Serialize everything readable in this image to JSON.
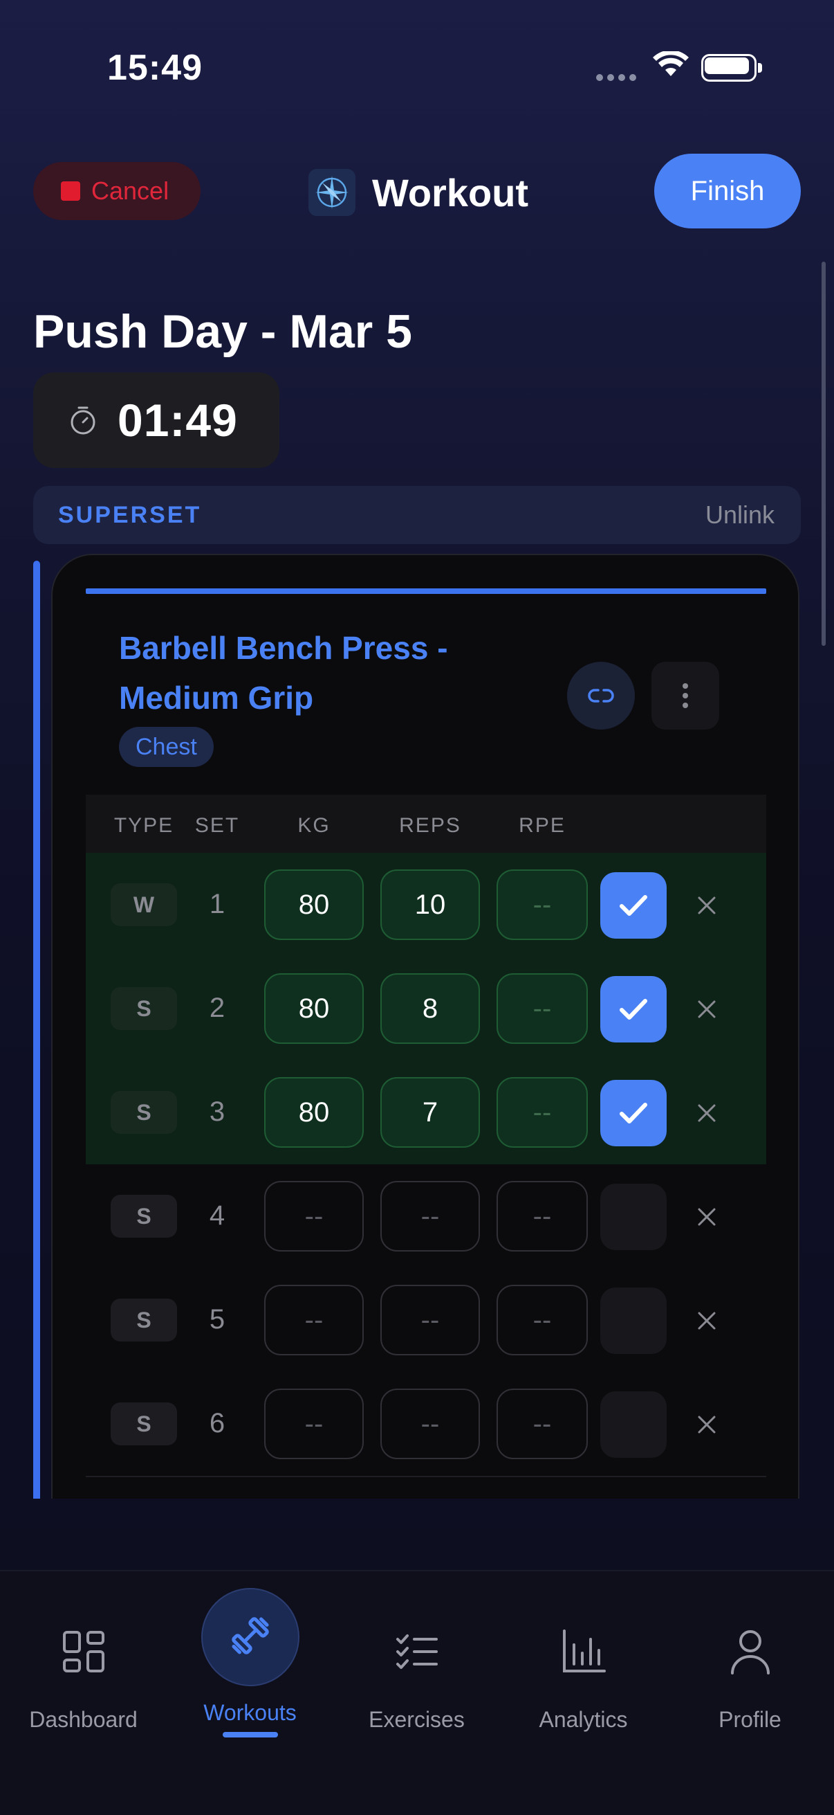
{
  "status_bar": {
    "time": "15:49"
  },
  "header": {
    "cancel_label": "Cancel",
    "title": "Workout",
    "finish_label": "Finish"
  },
  "workout": {
    "title": "Push Day - Mar 5",
    "timer": "01:49"
  },
  "superset": {
    "label": "SUPERSET",
    "unlink_label": "Unlink"
  },
  "exercise": {
    "name_line1": "Barbell Bench Press -",
    "name_line2": "Medium Grip",
    "muscle": "Chest",
    "columns": {
      "type": "TYPE",
      "set": "SET",
      "kg": "KG",
      "reps": "REPS",
      "rpe": "RPE"
    },
    "sets": [
      {
        "type": "W",
        "set": "1",
        "kg": "80",
        "reps": "10",
        "rpe": "--",
        "done": true
      },
      {
        "type": "S",
        "set": "2",
        "kg": "80",
        "reps": "8",
        "rpe": "--",
        "done": true
      },
      {
        "type": "S",
        "set": "3",
        "kg": "80",
        "reps": "7",
        "rpe": "--",
        "done": true
      },
      {
        "type": "S",
        "set": "4",
        "kg": "--",
        "reps": "--",
        "rpe": "--",
        "done": false
      },
      {
        "type": "S",
        "set": "5",
        "kg": "--",
        "reps": "--",
        "rpe": "--",
        "done": false
      },
      {
        "type": "S",
        "set": "6",
        "kg": "--",
        "reps": "--",
        "rpe": "--",
        "done": false
      }
    ]
  },
  "tabs": [
    {
      "label": "Dashboard",
      "icon": "dashboard-icon"
    },
    {
      "label": "Workouts",
      "icon": "dumbbell-icon",
      "active": true
    },
    {
      "label": "Exercises",
      "icon": "checklist-icon"
    },
    {
      "label": "Analytics",
      "icon": "bar-chart-icon"
    },
    {
      "label": "Profile",
      "icon": "person-icon"
    }
  ],
  "colors": {
    "accent": "#4a82f5",
    "cancel": "#e01c2e",
    "done_row": "#0e2318"
  }
}
